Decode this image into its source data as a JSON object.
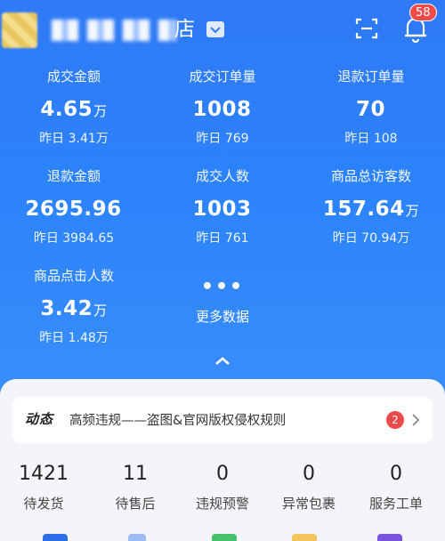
{
  "header": {
    "shop_name_suffix": "店",
    "notification_count": "58"
  },
  "stats": [
    {
      "label": "成交金额",
      "value": "4.65",
      "unit": "万",
      "prev": "昨日 3.41万"
    },
    {
      "label": "成交订单量",
      "value": "1008",
      "unit": "",
      "prev": "昨日 769"
    },
    {
      "label": "退款订单量",
      "value": "70",
      "unit": "",
      "prev": "昨日 108"
    },
    {
      "label": "退款金额",
      "value": "2695.96",
      "unit": "",
      "prev": "昨日 3984.65"
    },
    {
      "label": "成交人数",
      "value": "1003",
      "unit": "",
      "prev": "昨日 761"
    },
    {
      "label": "商品总访客数",
      "value": "157.64",
      "unit": "万",
      "prev": "昨日 70.94万"
    },
    {
      "label": "商品点击人数",
      "value": "3.42",
      "unit": "万",
      "prev": "昨日 1.48万"
    }
  ],
  "more": {
    "dots": "•••",
    "label": "更多数据"
  },
  "notice": {
    "tag": "动态",
    "text": "高频违规——盗图&官网版权侵权规则",
    "count": "2"
  },
  "orders": [
    {
      "num": "1421",
      "label": "待发货"
    },
    {
      "num": "11",
      "label": "待售后"
    },
    {
      "num": "0",
      "label": "违规预警"
    },
    {
      "num": "0",
      "label": "异常包裹"
    },
    {
      "num": "0",
      "label": "服务工单"
    }
  ],
  "colors": {
    "brand_blue": "#2f7cf6",
    "badge_red": "#ef4a4a",
    "panel_bg": "#f3f5f8"
  },
  "icons": {
    "scan": "scan-icon",
    "bell": "bell-icon",
    "dropdown": "chevron-down-icon",
    "collapse": "chevron-up-icon",
    "notice_arrow": "chevron-right-icon"
  }
}
